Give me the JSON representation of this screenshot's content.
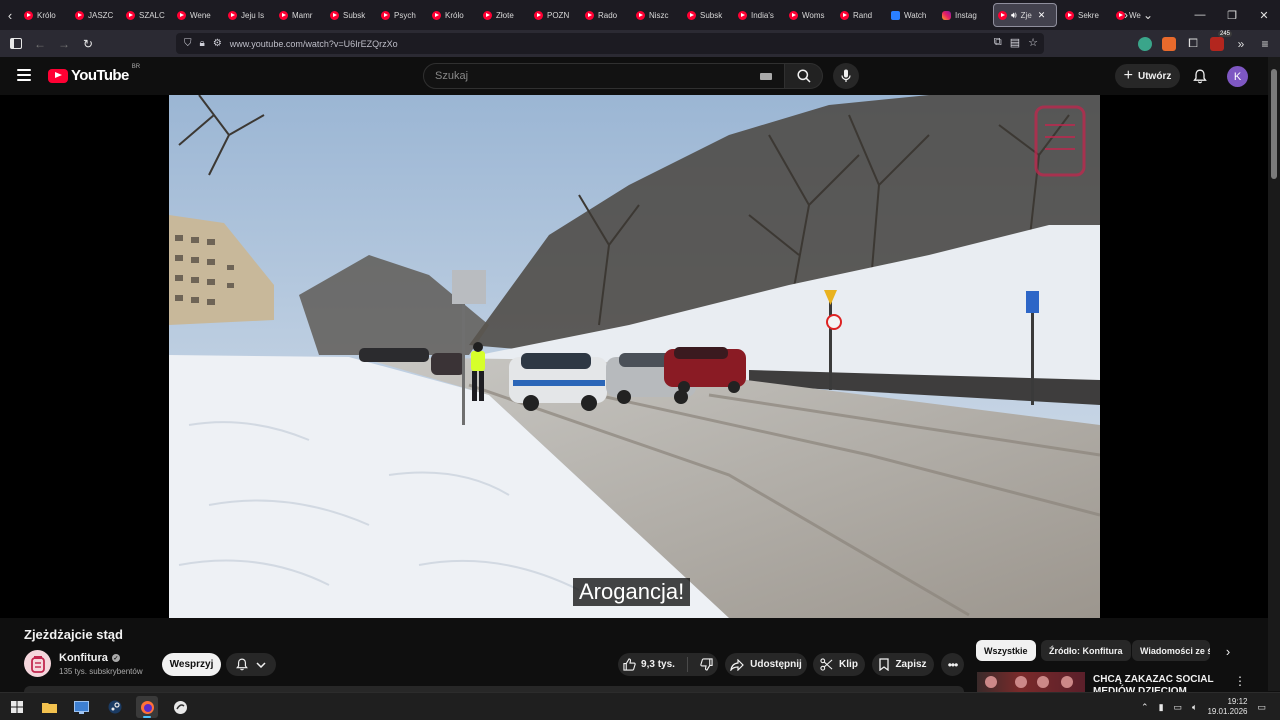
{
  "browser": {
    "tabs": [
      {
        "label": "Królo",
        "icon": "youtube-icon"
      },
      {
        "label": "JASZC",
        "icon": "youtube-icon"
      },
      {
        "label": "SZALC",
        "icon": "youtube-icon"
      },
      {
        "label": "Wene",
        "icon": "youtube-icon"
      },
      {
        "label": "Jeju Is",
        "icon": "youtube-icon"
      },
      {
        "label": "Mamr",
        "icon": "youtube-icon"
      },
      {
        "label": "Subsk",
        "icon": "youtube-icon"
      },
      {
        "label": "Psych",
        "icon": "youtube-icon"
      },
      {
        "label": "Królo",
        "icon": "youtube-icon"
      },
      {
        "label": "Złote",
        "icon": "youtube-icon"
      },
      {
        "label": "POZN",
        "icon": "youtube-icon"
      },
      {
        "label": "Rado",
        "icon": "youtube-icon"
      },
      {
        "label": "Niszc",
        "icon": "youtube-icon"
      },
      {
        "label": "Subsk",
        "icon": "youtube-icon"
      },
      {
        "label": "India's",
        "icon": "youtube-icon"
      },
      {
        "label": "Woms",
        "icon": "youtube-icon"
      },
      {
        "label": "Rand",
        "icon": "youtube-icon"
      },
      {
        "label": "Watch",
        "icon": "meta-icon"
      },
      {
        "label": "Instag",
        "icon": "instagram-icon"
      },
      {
        "label": "Zje",
        "icon": "youtube-icon",
        "active": true
      },
      {
        "label": "Sekre",
        "icon": "youtube-icon"
      },
      {
        "label": "We",
        "icon": "youtube-icon"
      }
    ],
    "url": "www.youtube.com/watch?v=U6IrEZQrzXo",
    "extension_badge": "245"
  },
  "youtube": {
    "logo_text": "YouTube",
    "logo_country": "BR",
    "search_placeholder": "Szukaj",
    "create_label": "Utwórz",
    "avatar_letter": "K"
  },
  "video": {
    "subtitle": "Arogancja!",
    "title": "Zjeżdżajcie stąd",
    "channel": "Konfitura",
    "subscribers": "135 tys. subskrybentów",
    "support_label": "Wesprzyj",
    "likes": "9,3 tys.",
    "share_label": "Udostępnij",
    "clip_label": "Klip",
    "save_label": "Zapisz"
  },
  "sidebar": {
    "chips": [
      "Wszystkie",
      "Źródło: Konfitura",
      "Wiadomości ze ś"
    ],
    "recommendation_title": "CHCĄ ZAKAZAĆ SOCIAL MEDIÓW DZIECIOM"
  },
  "taskbar": {
    "time": "19:12",
    "date": "19.01.2026"
  },
  "colors": {
    "youtube_red": "#ff0033",
    "background": "#0f0f0f",
    "chip_bg": "#272727",
    "avatar": "#7e57c2"
  }
}
